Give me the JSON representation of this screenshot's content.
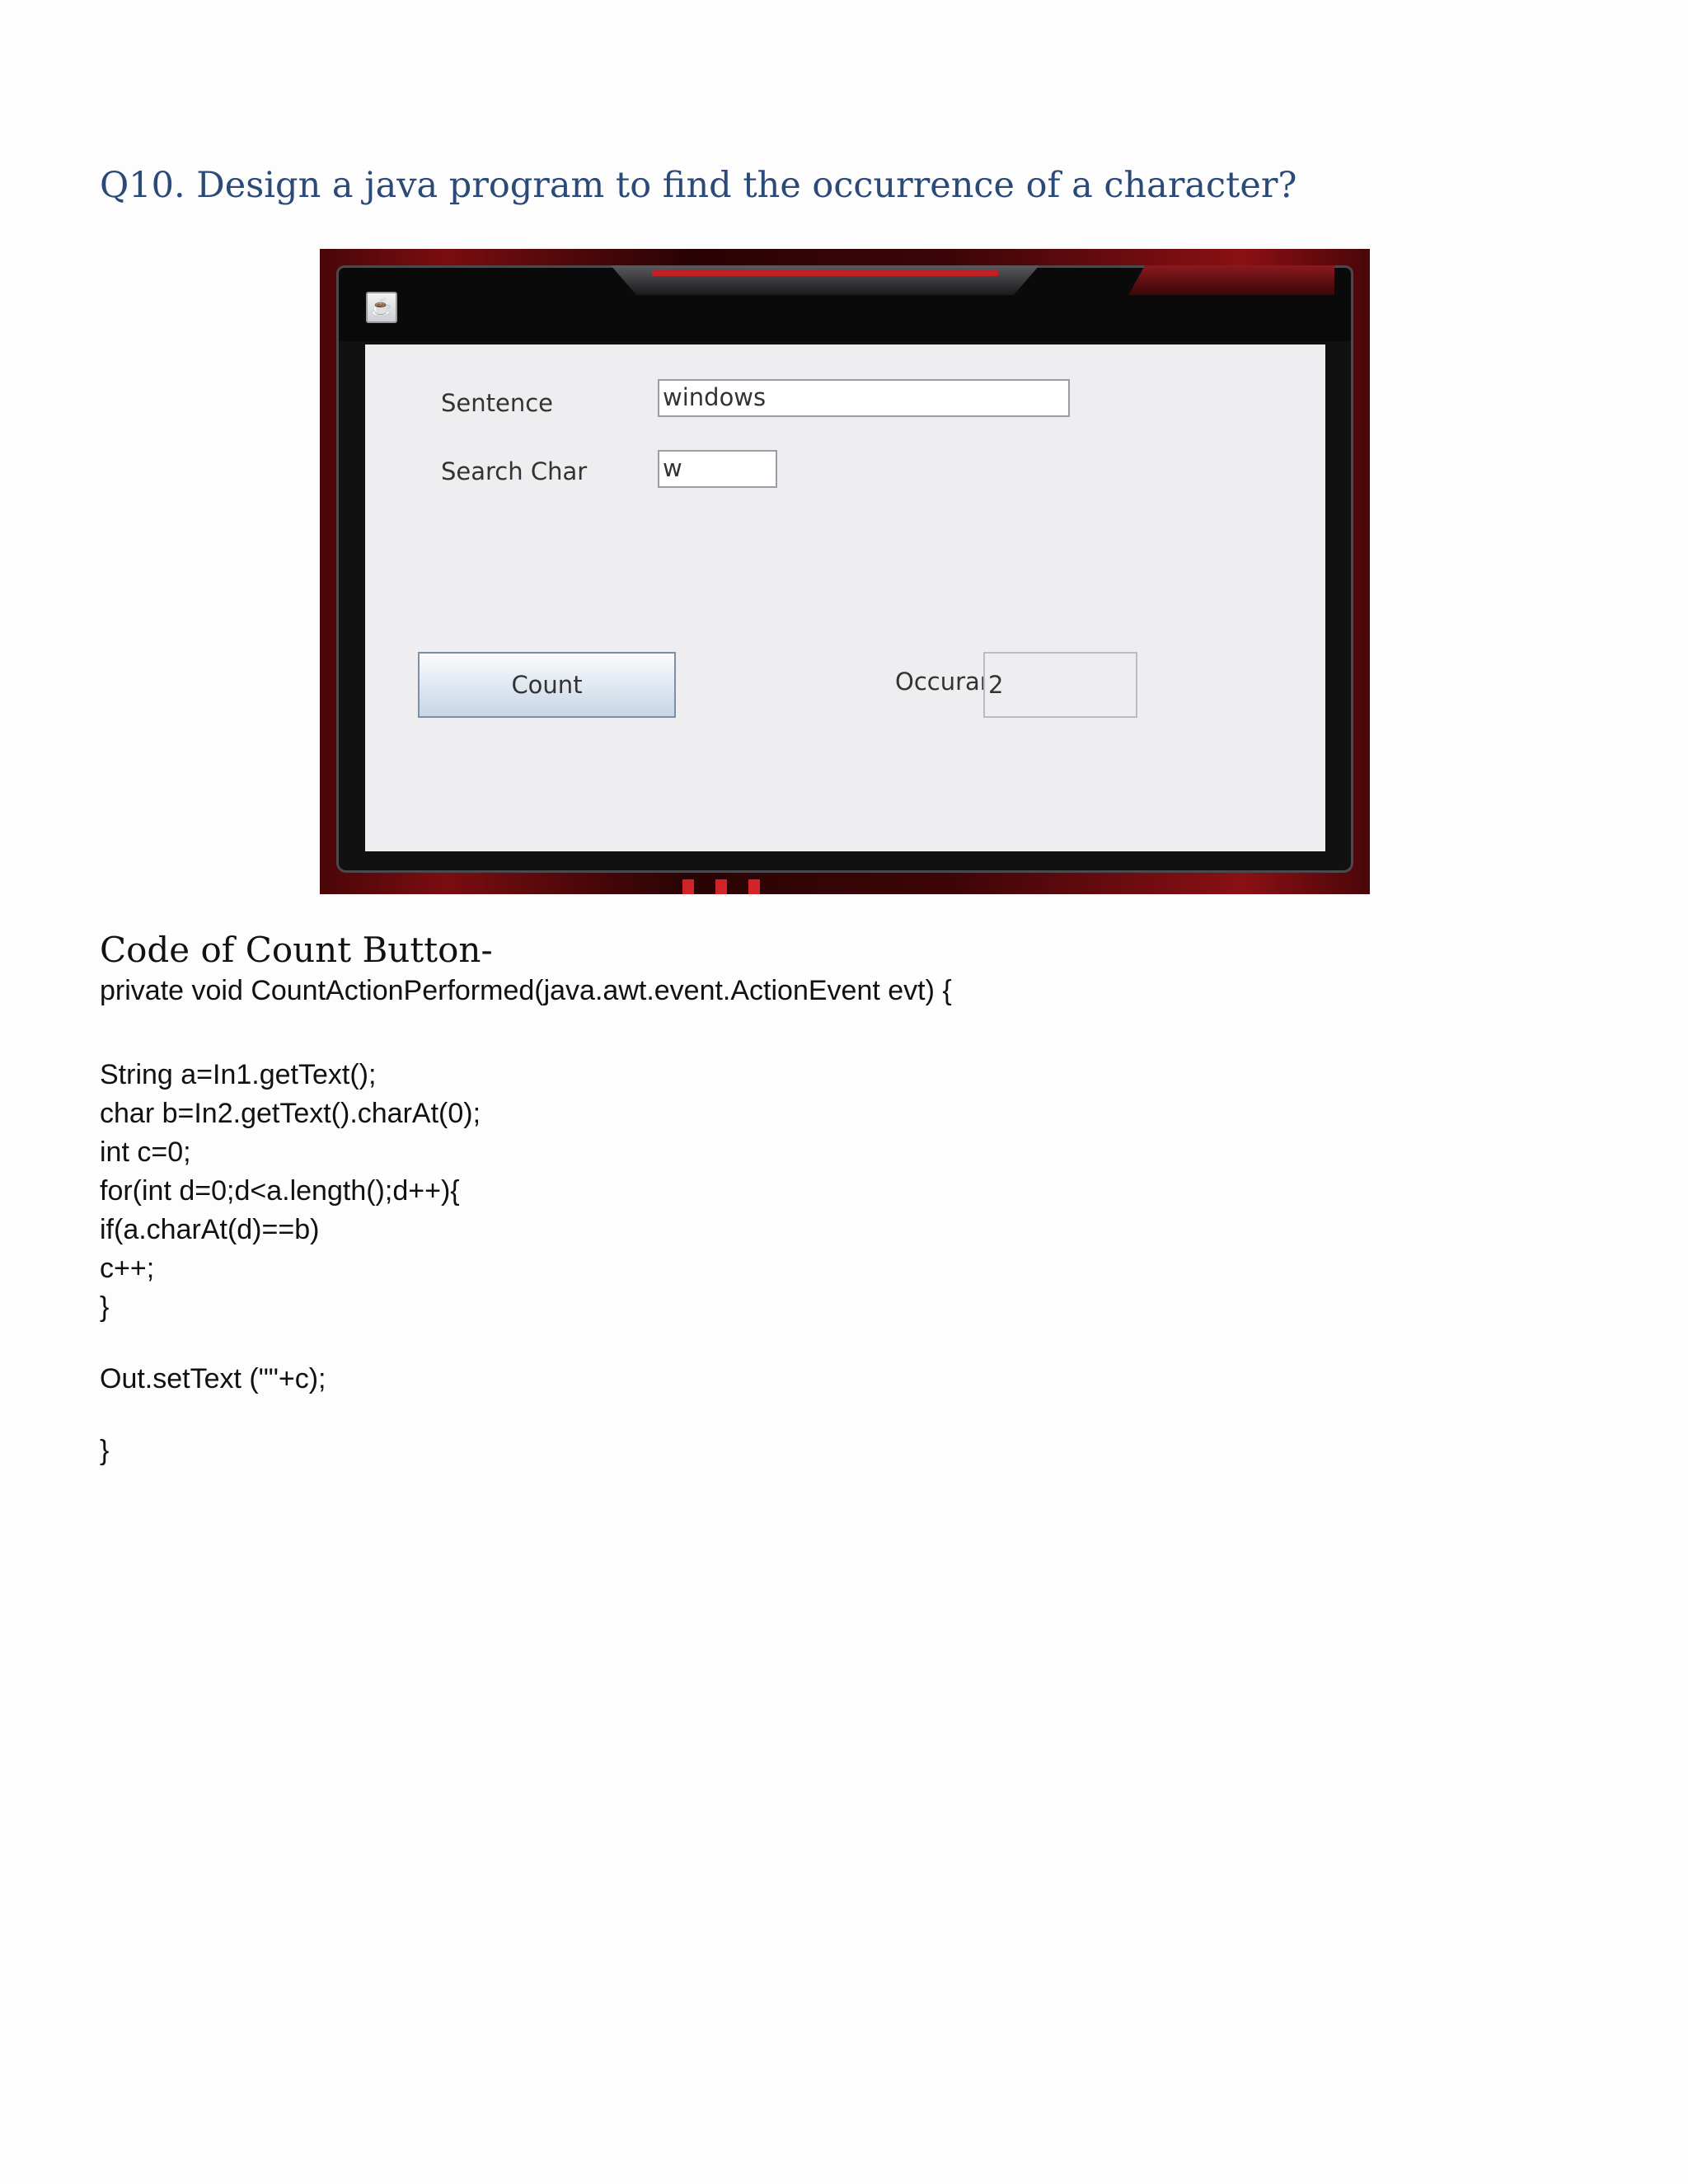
{
  "doc": {
    "heading": "Q10. Design a java program to find the occurrence of a character?",
    "subheading": "Code of Count Button-"
  },
  "app": {
    "sentence_label": "Sentence",
    "sentence_value": "windows",
    "search_label": "Search Char",
    "search_value": "w",
    "count_button": "Count",
    "occurance_label": "Occurance",
    "occurance_value": "2",
    "window_icon": "java-icon"
  },
  "code": {
    "lines": [
      "private void CountActionPerformed(java.awt.event.ActionEvent evt) {",
      "String a=In1.getText();",
      "char b=In2.getText().charAt(0);",
      "int c=0;",
      "for(int d=0;d<a.length();d++){",
      "if(a.charAt(d)==b)",
      "c++;",
      "}",
      "Out.setText (\"\"+c);",
      "}"
    ]
  },
  "colors": {
    "heading": "#2b4a78",
    "window_red": "#7a0d10"
  }
}
